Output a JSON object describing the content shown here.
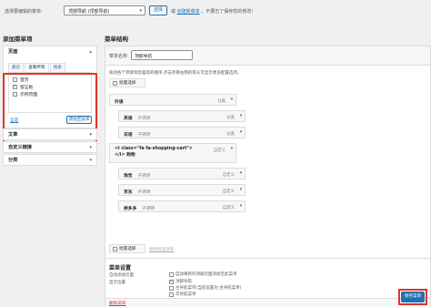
{
  "top": {
    "label": "选择要编辑的菜单:",
    "menu_select": "顶部导航 (顶部导航)",
    "select_button": "选择",
    "or_prefix": "或",
    "create_link": "创建新菜单",
    "save_reminder": "。不要忘了保存您的修改!"
  },
  "left": {
    "title": "添加菜单项",
    "pages": {
      "title": "页面",
      "tabs": [
        "最近",
        "查看所有",
        "搜索"
      ],
      "items": [
        {
          "label": "首页",
          "checked": false
        },
        {
          "label": "留言板",
          "checked": true
        },
        {
          "label": "示例页面",
          "checked": false
        }
      ],
      "select_all": "全选",
      "add_button": "添加至菜单"
    },
    "sections": [
      "文章",
      "自定义链接",
      "分类"
    ]
  },
  "right": {
    "title": "菜单结构",
    "name_label": "菜单名称",
    "name_value": "顶部导航",
    "hint": "拖动各个项目到您喜欢的顺序,点击项目右侧的箭头可显示更多配置选项。",
    "bulk_label": "批量选择",
    "items": [
      {
        "title": "外语",
        "sub": "",
        "type": "分类"
      },
      {
        "title": "英语",
        "sub": "子项目",
        "type": "分类"
      },
      {
        "title": "日语",
        "sub": "子项目",
        "type": "分类"
      },
      {
        "title": "<i class=\"fa fa-shopping-cart\">",
        "line2": "</i> 购物",
        "sub": "",
        "type": "自定义"
      },
      {
        "title": "淘宝",
        "sub": "子项目",
        "type": "自定义"
      },
      {
        "title": "京东",
        "sub": "子项目",
        "type": "自定义"
      },
      {
        "title": "拼多多",
        "sub": "子项目",
        "type": "自定义"
      }
    ],
    "bulk_label2": "批量选择",
    "remove_selected": "移除所选项目",
    "settings": {
      "title": "菜单设置",
      "auto_add_label": "自动添加页面",
      "auto_add_option": "自动将新的顶级页面添加至此菜单",
      "location_label": "显示位置",
      "locations": [
        {
          "label": "顶部导航",
          "checked": true
        },
        {
          "label": "主导航菜单(当前设置为:主导航菜单)",
          "checked": false
        },
        {
          "label": "次导航菜单",
          "checked": false
        }
      ]
    },
    "delete_link": "删除菜单",
    "save_button": "保存菜单"
  }
}
